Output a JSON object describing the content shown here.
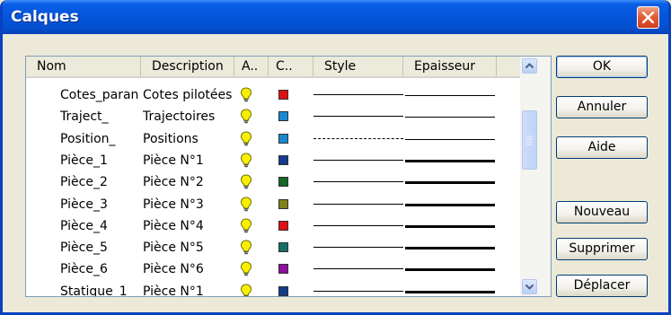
{
  "window": {
    "title": "Calques"
  },
  "icons": {
    "close": "close-icon",
    "scroll_up": "scroll-up-arrow-icon",
    "scroll_down": "scroll-down-arrow-icon",
    "visibility": "lightbulb-icon"
  },
  "colors": {
    "title_bar": "#0556dc",
    "close_button": "#e05a30",
    "bulb": "#f8f000"
  },
  "columns": [
    "Nom",
    "Description",
    "A..",
    "C..",
    "Style",
    "Epaisseur"
  ],
  "rows": [
    {
      "nom": "Cotes_paran",
      "description": "Cotes pilotées",
      "color": "#e01010",
      "style": "solid",
      "thick": false
    },
    {
      "nom": "Traject_",
      "description": "Trajectoires",
      "color": "#1a88d0",
      "style": "solid",
      "thick": false
    },
    {
      "nom": "Position_",
      "description": "Positions",
      "color": "#1a88d0",
      "style": "dashed",
      "thick": false
    },
    {
      "nom": "Pièce_1",
      "description": "Pièce N°1",
      "color": "#143c8c",
      "style": "solid",
      "thick": true
    },
    {
      "nom": "Pièce_2",
      "description": "Pièce N°2",
      "color": "#146828",
      "style": "solid",
      "thick": true
    },
    {
      "nom": "Pièce_3",
      "description": "Pièce N°3",
      "color": "#808018",
      "style": "solid",
      "thick": true
    },
    {
      "nom": "Pièce_4",
      "description": "Pièce N°4",
      "color": "#e01010",
      "style": "solid",
      "thick": true
    },
    {
      "nom": "Pièce_5",
      "description": "Pièce N°5",
      "color": "#147068",
      "style": "solid",
      "thick": true
    },
    {
      "nom": "Pièce_6",
      "description": "Pièce N°6",
      "color": "#9010a0",
      "style": "solid",
      "thick": true
    },
    {
      "nom": "Statique_1",
      "description": "Pièce N°1",
      "color": "#143c8c",
      "style": "solid",
      "thick": true
    }
  ],
  "buttons": {
    "ok": "OK",
    "annuler": "Annuler",
    "aide": "Aide",
    "nouveau": "Nouveau",
    "supprimer": "Supprimer",
    "deplacer": "Déplacer"
  }
}
